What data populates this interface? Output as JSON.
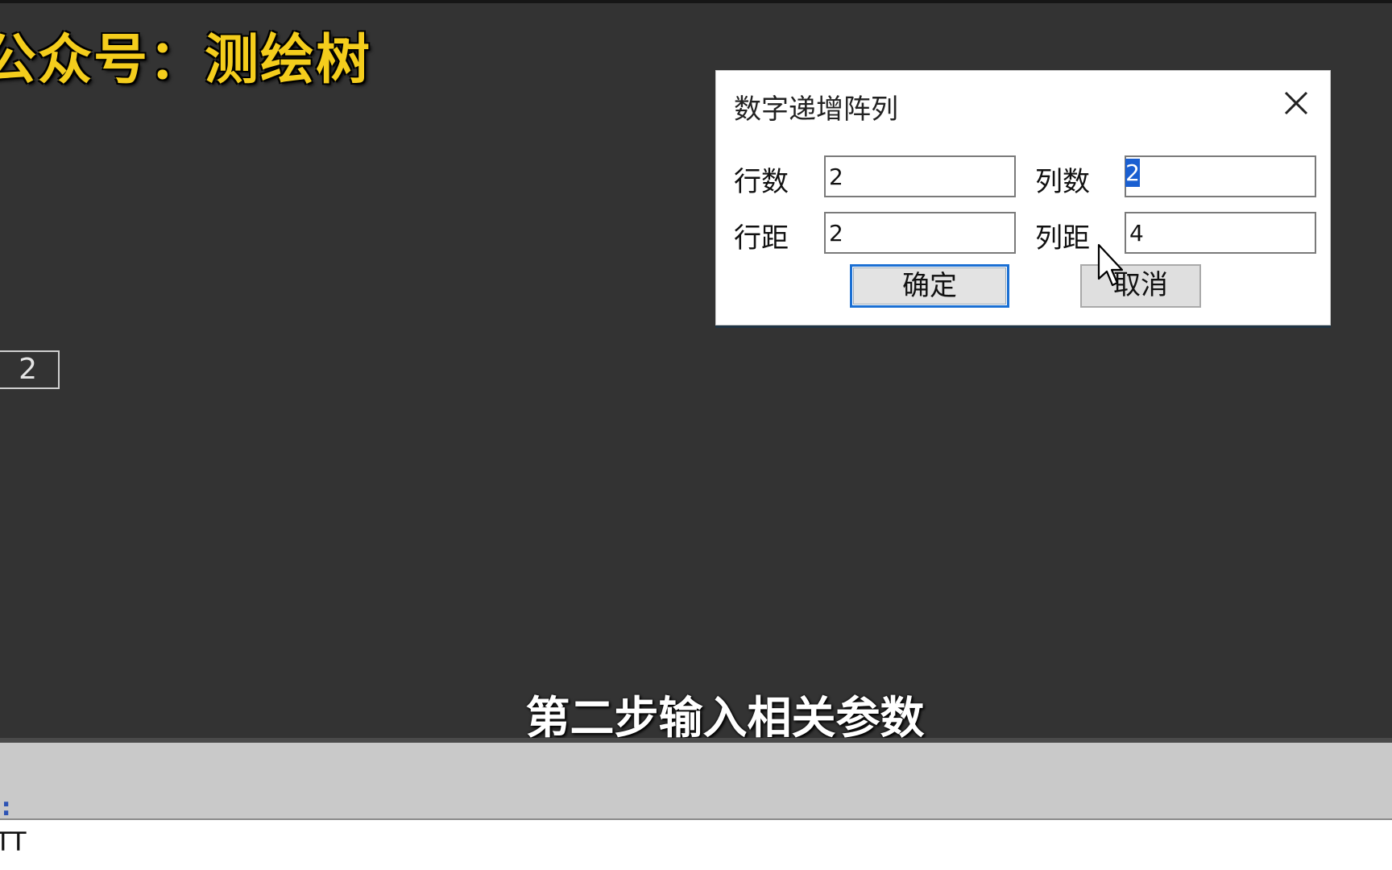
{
  "watermark": {
    "text": "公众号：测绘树"
  },
  "canvas": {
    "cell_value": "2"
  },
  "dialog": {
    "title": "数字递增阵列",
    "close_icon": "close-icon",
    "rows_label": "行数",
    "rows_value": "2",
    "cols_label": "列数",
    "cols_value": "2",
    "row_spacing_label": "行距",
    "row_spacing_value": "2",
    "col_spacing_label": "列距",
    "col_spacing_value": "4",
    "ok_label": "确定",
    "cancel_label": "取消"
  },
  "subtitle": {
    "text": "第二步输入相关参数"
  },
  "command": {
    "prompt": ":",
    "line_text": "TT"
  },
  "colors": {
    "background": "#333333",
    "watermark": "#f4cd1c",
    "accent": "#1a6fd3",
    "selection": "#1a5fd1"
  }
}
